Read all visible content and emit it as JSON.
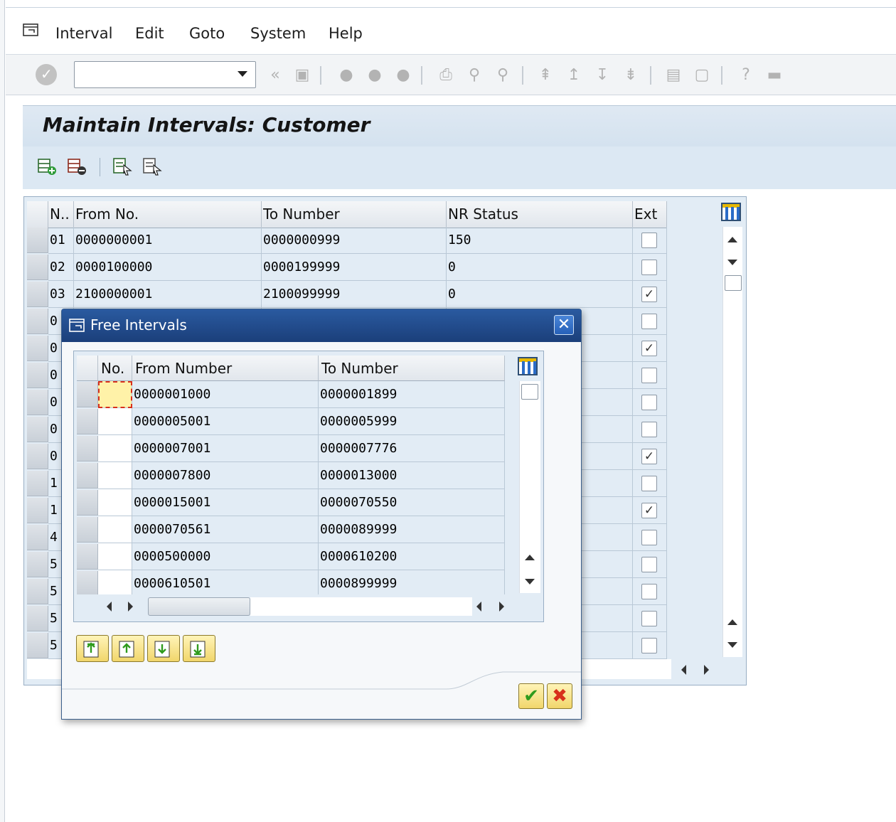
{
  "menu": {
    "items": [
      {
        "label": "Interval",
        "underline": "I"
      },
      {
        "label": "Edit",
        "underline": "E"
      },
      {
        "label": "Goto",
        "underline": "G"
      },
      {
        "label": "System",
        "underline": "y"
      },
      {
        "label": "Help",
        "underline": "H"
      }
    ]
  },
  "toolbar": {
    "command_field_value": ""
  },
  "page": {
    "title": "Maintain Intervals: Customer"
  },
  "main_table": {
    "columns": [
      "N..",
      "From No.",
      "To Number",
      "NR Status",
      "Ext"
    ],
    "rows": [
      {
        "no": "01",
        "from": "0000000001",
        "to": "0000000999",
        "status": "150",
        "ext": false
      },
      {
        "no": "02",
        "from": "0000100000",
        "to": "0000199999",
        "status": "0",
        "ext": false
      },
      {
        "no": "03",
        "from": "2100000001",
        "to": "2100099999",
        "status": "0",
        "ext": true
      },
      {
        "no": "0",
        "from": "",
        "to": "",
        "status": "",
        "ext": false
      },
      {
        "no": "0",
        "from": "",
        "to": "",
        "status": "",
        "ext": true
      },
      {
        "no": "0",
        "from": "",
        "to": "",
        "status": "",
        "ext": false
      },
      {
        "no": "0",
        "from": "",
        "to": "",
        "status": "",
        "ext": false
      },
      {
        "no": "0",
        "from": "",
        "to": "",
        "status": "",
        "ext": false
      },
      {
        "no": "0",
        "from": "",
        "to": "",
        "status": "",
        "ext": true
      },
      {
        "no": "1",
        "from": "",
        "to": "",
        "status": "",
        "ext": false
      },
      {
        "no": "1",
        "from": "",
        "to": "",
        "status": "",
        "ext": true
      },
      {
        "no": "4",
        "from": "",
        "to": "",
        "status": "",
        "ext": false
      },
      {
        "no": "5",
        "from": "",
        "to": "",
        "status": "",
        "ext": false
      },
      {
        "no": "5",
        "from": "",
        "to": "",
        "status": "",
        "ext": false
      },
      {
        "no": "5",
        "from": "",
        "to": "",
        "status": "",
        "ext": false
      },
      {
        "no": "5",
        "from": "",
        "to": "",
        "status": "",
        "ext": false
      }
    ]
  },
  "dialog": {
    "title": "Free Intervals",
    "close_glyph": "✕",
    "columns": [
      "No.",
      "From Number",
      "To Number"
    ],
    "rows": [
      {
        "no": "",
        "from": "0000001000",
        "to": "0000001899"
      },
      {
        "no": "",
        "from": "0000005001",
        "to": "0000005999"
      },
      {
        "no": "",
        "from": "0000007001",
        "to": "0000007776"
      },
      {
        "no": "",
        "from": "0000007800",
        "to": "0000013000"
      },
      {
        "no": "",
        "from": "0000015001",
        "to": "0000070550"
      },
      {
        "no": "",
        "from": "0000070561",
        "to": "0000089999"
      },
      {
        "no": "",
        "from": "0000500000",
        "to": "0000610200"
      },
      {
        "no": "",
        "from": "0000610501",
        "to": "0000899999"
      }
    ],
    "ok_glyph": "✔",
    "cancel_glyph": "✖"
  },
  "colors": {
    "dialog_title_bg": "#1b3f7a",
    "table_bg": "#e2ecf5",
    "focus_cell": "#fff2a8",
    "focus_border": "#d8301c",
    "nav_button": "#f1d66b"
  }
}
